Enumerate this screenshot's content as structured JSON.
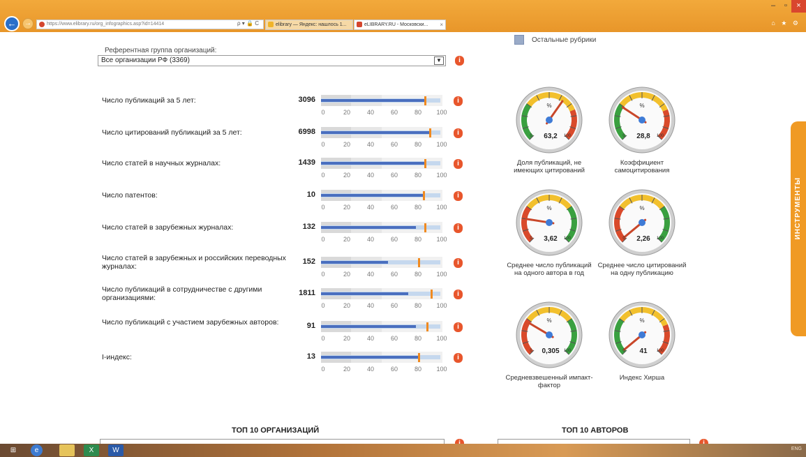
{
  "browser": {
    "url": "https://www.elibrary.ru/org_infographics.asp?id=14414",
    "address_tools": "ρ ▾ 🔒 C",
    "tabs": [
      {
        "label": "elibrary — Яндекс: нашлось 1...",
        "favicon_color": "#f0b429"
      },
      {
        "label": "eLIBRARY.RU - Московски...",
        "favicon_color": "#d4462e"
      }
    ],
    "window_controls": {
      "minimize": "–",
      "maximize": "▫",
      "close": "×"
    },
    "toolbar_icons": "⌂ ★ ⚙"
  },
  "reference_group": {
    "label": "Референтная группа организаций:",
    "selected": "Все организации РФ (3369)",
    "dropdown_icon": "chevron-down-icon"
  },
  "info_glyph": "i",
  "axis_ticks": [
    "0",
    "20",
    "40",
    "60",
    "80",
    "100"
  ],
  "metrics": [
    {
      "label": "Число публикаций за 5 лет:",
      "value": "3096",
      "bar": 0.86,
      "ref": 0.98,
      "marker": 0.85
    },
    {
      "label": "Число цитирований публикаций за 5 лет:",
      "value": "6998",
      "bar": 0.89,
      "ref": 0.98,
      "marker": 0.89
    },
    {
      "label": "Число статей в научных журналах:",
      "value": "1439",
      "bar": 0.86,
      "ref": 0.98,
      "marker": 0.85
    },
    {
      "label": "Число патентов:",
      "value": "10",
      "bar": 0.84,
      "ref": 0.98,
      "marker": 0.84
    },
    {
      "label": "Число статей в зарубежных журналах:",
      "value": "132",
      "bar": 0.78,
      "ref": 0.98,
      "marker": 0.85
    },
    {
      "label": "Число статей в зарубежных и российских переводных журналах:",
      "value": "152",
      "bar": 0.55,
      "ref": 0.98,
      "marker": 0.8
    },
    {
      "label": "Число публикаций в сотрудничестве с другими организациями:",
      "value": "1811",
      "bar": 0.72,
      "ref": 0.98,
      "marker": 0.9
    },
    {
      "label": "Число публикаций с участием зарубежных авторов:",
      "value": "91",
      "bar": 0.78,
      "ref": 0.98,
      "marker": 0.87
    },
    {
      "label": "I-индекс:",
      "value": "13",
      "bar": 0.8,
      "ref": 0.98,
      "marker": 0.8
    }
  ],
  "legend": {
    "label": "Остальные рубрики",
    "color": "#9aabc8"
  },
  "gauges": [
    {
      "value": "63,2",
      "caption": "Доля публикаций, не имеющих цитирований",
      "needle": 0.63,
      "min": "0",
      "max": "100",
      "unit": "%"
    },
    {
      "value": "28,8",
      "caption": "Коэффициент самоцитирования",
      "needle": 0.29,
      "min": "0",
      "max": "100",
      "unit": "%"
    },
    {
      "value": "3,62",
      "caption": "Среднее число публикаций на одного автора в год",
      "needle": 0.2,
      "min": "0",
      "max": "100",
      "unit": "%"
    },
    {
      "value": "2,26",
      "caption": "Среднее число цитирований на одну публикацию",
      "needle": 0.02,
      "min": "0",
      "max": "100",
      "unit": "%"
    },
    {
      "value": "0,305",
      "caption": "Средневзвешенный импакт-фактор",
      "needle": 0.28,
      "min": "0",
      "max": "100",
      "unit": "%"
    },
    {
      "value": "41",
      "caption": "Индекс Хирша",
      "needle": 0.02,
      "min": "0",
      "max": "100",
      "unit": "%"
    }
  ],
  "sections": {
    "top_orgs": "ТОП 10 ОРГАНИЗАЦИЙ",
    "top_authors": "ТОП 10 АВТОРОВ"
  },
  "tools_tab": "ИНСТРУМЕНТЫ",
  "taskbar": {
    "items": [
      "start",
      "ie",
      "folder",
      "excel",
      "word"
    ],
    "tray": "ENG"
  }
}
